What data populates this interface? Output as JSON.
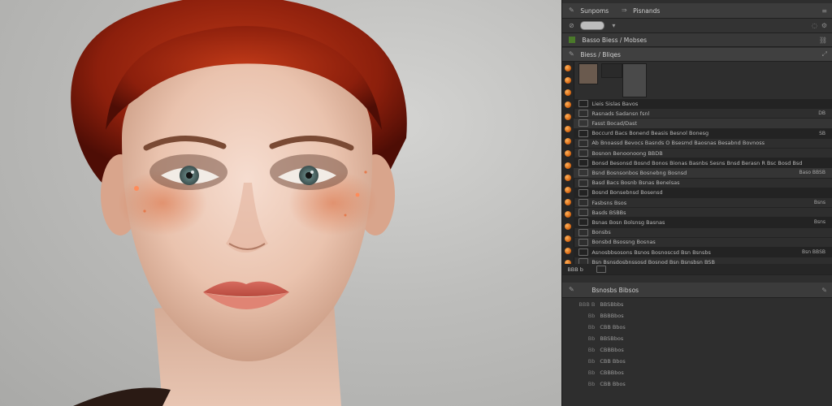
{
  "toolbar": {
    "row1_label_a": "Sunpoms",
    "row1_label_b": "Pisnands",
    "row3_label": "Basso Biess / Mobses",
    "row4_label": "Biess / Bliqes"
  },
  "layers": {
    "rows": [
      {
        "text": "Lieis Sislas Bavos",
        "tag": ""
      },
      {
        "text": "Rasnads Sadansn fsnl",
        "tag": "DB"
      },
      {
        "text": "Fasst Bocad/Dast",
        "tag": ""
      },
      {
        "text": "Boccurd Bacs Bonend Beasis Besnol Bonesg",
        "tag": "SB"
      },
      {
        "text": "Ab Bnoassd Bevocs Basnds O Bsesmd Baosnas Besabnd Bovnoss",
        "tag": ""
      },
      {
        "text": "Bosnon Benoonoong BBDB",
        "tag": ""
      },
      {
        "text": "Bonsd Besonsd Bosnd Bonos Bionas Basnbs Sesns Bnsd Berasn R Bsc Bosd Bsd",
        "tag": ""
      },
      {
        "text": "Bsnd Bosnsonbos Bosnebng Bosnsd",
        "tag": "Baso BBSB"
      },
      {
        "text": "Basd Bacs Bosnb Bsnas Benelsas",
        "tag": ""
      },
      {
        "text": "Bosnd Bonsebnsd Bosensd",
        "tag": ""
      },
      {
        "text": "Fasbsns Bsos",
        "tag": "Bsns"
      },
      {
        "text": "Basds BSBBs",
        "tag": ""
      },
      {
        "text": "Bsnas Bosn Bolsnsg Basnas",
        "tag": "Bsns"
      },
      {
        "text": "Bonsbs",
        "tag": ""
      },
      {
        "text": "Bonsbd Bsossng Bosnas",
        "tag": ""
      },
      {
        "text": "Asnosbbsosons Bsnos Bosnoscsd Bsn Bsnsbs",
        "tag": "Bsn BBSB"
      },
      {
        "text": "Bsn Bsnsdosbnssosd Bosnod Bsn Bsnsbsn BSB",
        "tag": ""
      }
    ]
  },
  "footer_row": {
    "num": "BBB b",
    "text": ""
  },
  "panel2": {
    "title": "Bsnosbs Bibsos",
    "items": [
      {
        "num": "BBB B",
        "text": "BBSBbbs"
      },
      {
        "num": "Bb",
        "text": "BBBBbos"
      },
      {
        "num": "Bb",
        "text": "CBB Bbos"
      },
      {
        "num": "Bb",
        "text": "BBSBbos"
      },
      {
        "num": "Bb",
        "text": "CBBBbos"
      },
      {
        "num": "Bb",
        "text": "CBB Bbos"
      },
      {
        "num": "Bb",
        "text": "CBBBbos"
      },
      {
        "num": "Bb",
        "text": "CBB Bbos"
      }
    ]
  }
}
